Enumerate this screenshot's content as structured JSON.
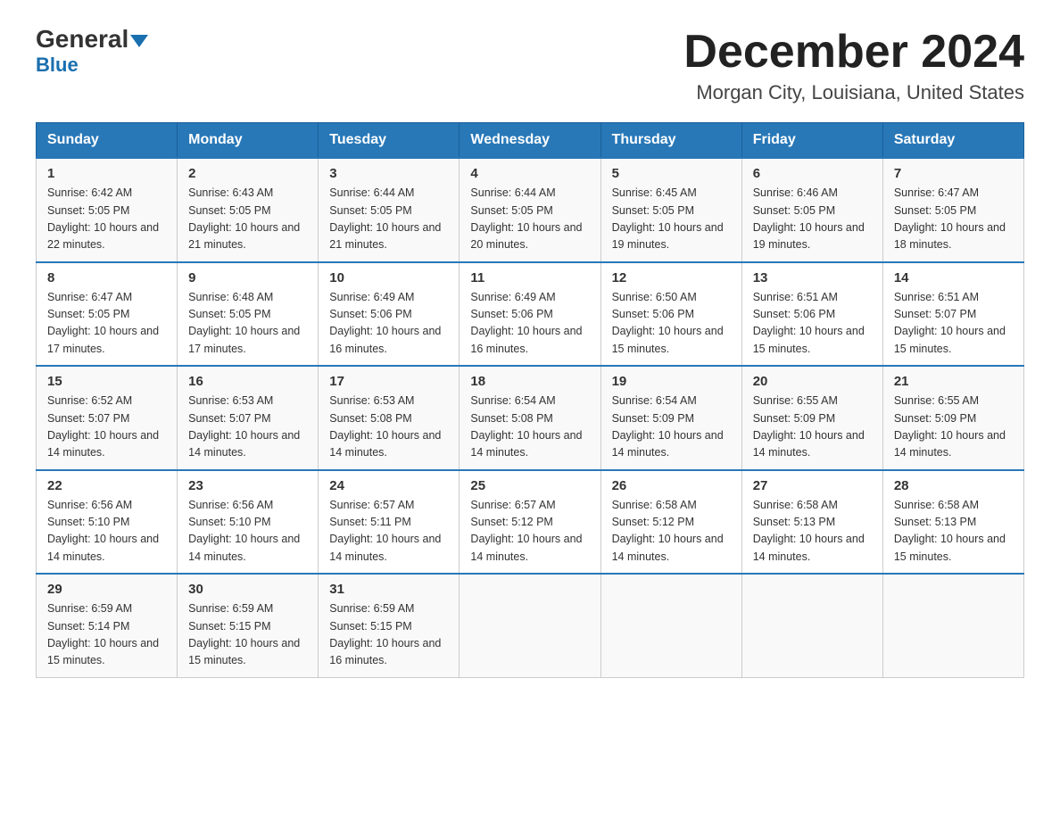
{
  "header": {
    "logo_main": "General",
    "logo_sub": "Blue",
    "month_title": "December 2024",
    "location": "Morgan City, Louisiana, United States"
  },
  "weekdays": [
    "Sunday",
    "Monday",
    "Tuesday",
    "Wednesday",
    "Thursday",
    "Friday",
    "Saturday"
  ],
  "weeks": [
    [
      {
        "day": "1",
        "sunrise": "Sunrise: 6:42 AM",
        "sunset": "Sunset: 5:05 PM",
        "daylight": "Daylight: 10 hours and 22 minutes."
      },
      {
        "day": "2",
        "sunrise": "Sunrise: 6:43 AM",
        "sunset": "Sunset: 5:05 PM",
        "daylight": "Daylight: 10 hours and 21 minutes."
      },
      {
        "day": "3",
        "sunrise": "Sunrise: 6:44 AM",
        "sunset": "Sunset: 5:05 PM",
        "daylight": "Daylight: 10 hours and 21 minutes."
      },
      {
        "day": "4",
        "sunrise": "Sunrise: 6:44 AM",
        "sunset": "Sunset: 5:05 PM",
        "daylight": "Daylight: 10 hours and 20 minutes."
      },
      {
        "day": "5",
        "sunrise": "Sunrise: 6:45 AM",
        "sunset": "Sunset: 5:05 PM",
        "daylight": "Daylight: 10 hours and 19 minutes."
      },
      {
        "day": "6",
        "sunrise": "Sunrise: 6:46 AM",
        "sunset": "Sunset: 5:05 PM",
        "daylight": "Daylight: 10 hours and 19 minutes."
      },
      {
        "day": "7",
        "sunrise": "Sunrise: 6:47 AM",
        "sunset": "Sunset: 5:05 PM",
        "daylight": "Daylight: 10 hours and 18 minutes."
      }
    ],
    [
      {
        "day": "8",
        "sunrise": "Sunrise: 6:47 AM",
        "sunset": "Sunset: 5:05 PM",
        "daylight": "Daylight: 10 hours and 17 minutes."
      },
      {
        "day": "9",
        "sunrise": "Sunrise: 6:48 AM",
        "sunset": "Sunset: 5:05 PM",
        "daylight": "Daylight: 10 hours and 17 minutes."
      },
      {
        "day": "10",
        "sunrise": "Sunrise: 6:49 AM",
        "sunset": "Sunset: 5:06 PM",
        "daylight": "Daylight: 10 hours and 16 minutes."
      },
      {
        "day": "11",
        "sunrise": "Sunrise: 6:49 AM",
        "sunset": "Sunset: 5:06 PM",
        "daylight": "Daylight: 10 hours and 16 minutes."
      },
      {
        "day": "12",
        "sunrise": "Sunrise: 6:50 AM",
        "sunset": "Sunset: 5:06 PM",
        "daylight": "Daylight: 10 hours and 15 minutes."
      },
      {
        "day": "13",
        "sunrise": "Sunrise: 6:51 AM",
        "sunset": "Sunset: 5:06 PM",
        "daylight": "Daylight: 10 hours and 15 minutes."
      },
      {
        "day": "14",
        "sunrise": "Sunrise: 6:51 AM",
        "sunset": "Sunset: 5:07 PM",
        "daylight": "Daylight: 10 hours and 15 minutes."
      }
    ],
    [
      {
        "day": "15",
        "sunrise": "Sunrise: 6:52 AM",
        "sunset": "Sunset: 5:07 PM",
        "daylight": "Daylight: 10 hours and 14 minutes."
      },
      {
        "day": "16",
        "sunrise": "Sunrise: 6:53 AM",
        "sunset": "Sunset: 5:07 PM",
        "daylight": "Daylight: 10 hours and 14 minutes."
      },
      {
        "day": "17",
        "sunrise": "Sunrise: 6:53 AM",
        "sunset": "Sunset: 5:08 PM",
        "daylight": "Daylight: 10 hours and 14 minutes."
      },
      {
        "day": "18",
        "sunrise": "Sunrise: 6:54 AM",
        "sunset": "Sunset: 5:08 PM",
        "daylight": "Daylight: 10 hours and 14 minutes."
      },
      {
        "day": "19",
        "sunrise": "Sunrise: 6:54 AM",
        "sunset": "Sunset: 5:09 PM",
        "daylight": "Daylight: 10 hours and 14 minutes."
      },
      {
        "day": "20",
        "sunrise": "Sunrise: 6:55 AM",
        "sunset": "Sunset: 5:09 PM",
        "daylight": "Daylight: 10 hours and 14 minutes."
      },
      {
        "day": "21",
        "sunrise": "Sunrise: 6:55 AM",
        "sunset": "Sunset: 5:09 PM",
        "daylight": "Daylight: 10 hours and 14 minutes."
      }
    ],
    [
      {
        "day": "22",
        "sunrise": "Sunrise: 6:56 AM",
        "sunset": "Sunset: 5:10 PM",
        "daylight": "Daylight: 10 hours and 14 minutes."
      },
      {
        "day": "23",
        "sunrise": "Sunrise: 6:56 AM",
        "sunset": "Sunset: 5:10 PM",
        "daylight": "Daylight: 10 hours and 14 minutes."
      },
      {
        "day": "24",
        "sunrise": "Sunrise: 6:57 AM",
        "sunset": "Sunset: 5:11 PM",
        "daylight": "Daylight: 10 hours and 14 minutes."
      },
      {
        "day": "25",
        "sunrise": "Sunrise: 6:57 AM",
        "sunset": "Sunset: 5:12 PM",
        "daylight": "Daylight: 10 hours and 14 minutes."
      },
      {
        "day": "26",
        "sunrise": "Sunrise: 6:58 AM",
        "sunset": "Sunset: 5:12 PM",
        "daylight": "Daylight: 10 hours and 14 minutes."
      },
      {
        "day": "27",
        "sunrise": "Sunrise: 6:58 AM",
        "sunset": "Sunset: 5:13 PM",
        "daylight": "Daylight: 10 hours and 14 minutes."
      },
      {
        "day": "28",
        "sunrise": "Sunrise: 6:58 AM",
        "sunset": "Sunset: 5:13 PM",
        "daylight": "Daylight: 10 hours and 15 minutes."
      }
    ],
    [
      {
        "day": "29",
        "sunrise": "Sunrise: 6:59 AM",
        "sunset": "Sunset: 5:14 PM",
        "daylight": "Daylight: 10 hours and 15 minutes."
      },
      {
        "day": "30",
        "sunrise": "Sunrise: 6:59 AM",
        "sunset": "Sunset: 5:15 PM",
        "daylight": "Daylight: 10 hours and 15 minutes."
      },
      {
        "day": "31",
        "sunrise": "Sunrise: 6:59 AM",
        "sunset": "Sunset: 5:15 PM",
        "daylight": "Daylight: 10 hours and 16 minutes."
      },
      null,
      null,
      null,
      null
    ]
  ]
}
